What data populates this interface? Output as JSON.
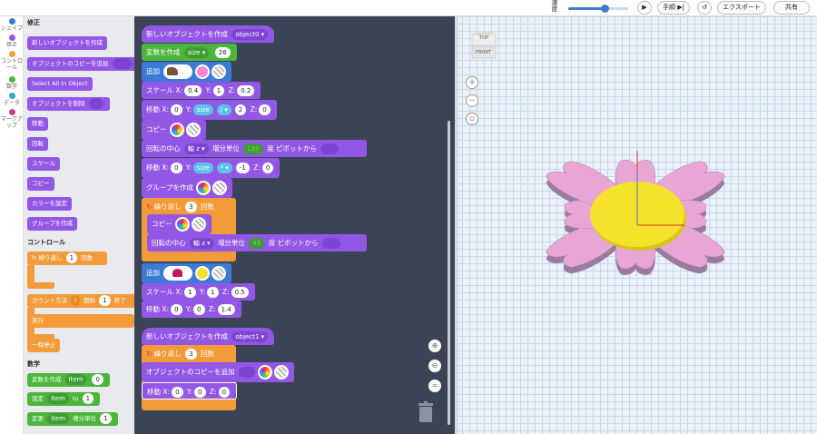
{
  "topbar": {
    "speed_label": "速度",
    "speed_fraction": 0.6,
    "buttons": {
      "play": "▶",
      "step": "手順",
      "reset": "↺",
      "export": "エクスポート",
      "share": "共有"
    }
  },
  "categories": [
    {
      "label": "シェイプ",
      "color": "#3b7bd6"
    },
    {
      "label": "修正",
      "color": "#9357e6"
    },
    {
      "label": "コントロール",
      "color": "#f29b38"
    },
    {
      "label": "数学",
      "color": "#4cb53b"
    },
    {
      "label": "データ",
      "color": "#32a8c9"
    },
    {
      "label": "マークアップ",
      "color": "#cc3d8c"
    }
  ],
  "flyout": {
    "modify_header": "修正",
    "modify_blocks": [
      "新しいオブジェクトを作成",
      "オブジェクトのコピーを追加",
      "Select All In Object",
      "オブジェクトを削除",
      "移動",
      "回転",
      "スケール",
      "コピー",
      "カラーを設定",
      "グループを作成"
    ],
    "control_header": "コントロール",
    "repeat_label": "繰り返し",
    "repeat_count": "1",
    "repeat_suffix": "回数",
    "count_label": "カウント方法",
    "count_var": "i",
    "count_start_label": "開始",
    "count_start": "1",
    "count_end_label": "終了",
    "exec_label": "実行",
    "pause_label": "一時停止",
    "math_header": "数学",
    "var_create_label": "変数を作成",
    "var_name": "item",
    "var_value": "0",
    "set_label": "設定",
    "set_var": "item",
    "set_to": "to",
    "set_value": "1",
    "change_label": "変更",
    "change_var": "item",
    "change_unit": "増分単位",
    "change_value": "1"
  },
  "workspace": {
    "new_object": "新しいオブジェクトを作成",
    "object0": "object0",
    "var_create": "変数を作成",
    "size_var": "size",
    "size_value": "26",
    "add": "追加",
    "scale": "スケール",
    "scale1": {
      "x": "0.4",
      "y": "1",
      "z": "0.2"
    },
    "move": "移動",
    "move1": {
      "x": "0",
      "y_var": "size",
      "op": "/",
      "y_num": "2",
      "z": "0"
    },
    "copy": "コピー",
    "rotate_center": "回転の中心",
    "axis": "軸 z",
    "unit": "増分単位",
    "angle1": "180",
    "degree": "度",
    "pivot": "ピボットから",
    "move2": {
      "x": "0",
      "y_var": "size",
      "op": "*",
      "y_num": "-1",
      "z": "0"
    },
    "group": "グループを作成",
    "repeat": "繰り返し",
    "repeat_count1": "3",
    "times": "回数",
    "angle2": "45",
    "scale2": {
      "x": "1",
      "y": "1",
      "z": "0.5"
    },
    "move3": {
      "x": "0",
      "y": "0",
      "z": "1.4"
    },
    "object1": "object1",
    "repeat_count2": "3",
    "add_copy": "オブジェクトのコピーを追加",
    "move4": {
      "x": "0",
      "y": "0",
      "z": "0"
    },
    "axis_x": "X:",
    "axis_y": "Y:",
    "axis_z": "Z:"
  },
  "viewer": {
    "cube_top": "TOP",
    "cube_front": "FRONT",
    "petal_color": "#e8a6d4",
    "center_color": "#f5e22a"
  }
}
